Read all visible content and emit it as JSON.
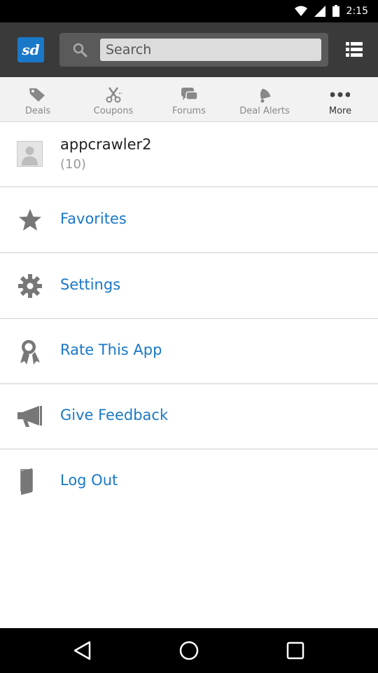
{
  "status_bar": {
    "time": "2:15"
  },
  "header": {
    "logo_text": "sd",
    "search_placeholder": "Search"
  },
  "tabs": [
    {
      "label": "Deals",
      "icon": "tag-icon"
    },
    {
      "label": "Coupons",
      "icon": "scissors-icon"
    },
    {
      "label": "Forums",
      "icon": "chat-icon"
    },
    {
      "label": "Deal Alerts",
      "icon": "bell-icon"
    },
    {
      "label": "More",
      "icon": "more-dots-icon",
      "active": true
    }
  ],
  "profile": {
    "username": "appcrawler2",
    "count": "(10)"
  },
  "menu": [
    {
      "label": "Favorites",
      "icon": "star-icon"
    },
    {
      "label": "Settings",
      "icon": "gear-icon"
    },
    {
      "label": "Rate This App",
      "icon": "ribbon-icon"
    },
    {
      "label": "Give Feedback",
      "icon": "megaphone-icon"
    },
    {
      "label": "Log Out",
      "icon": "door-icon"
    }
  ],
  "colors": {
    "accent": "#1a78c8",
    "appbar": "#3a3a3a",
    "tabbar": "#f2f2f2"
  }
}
